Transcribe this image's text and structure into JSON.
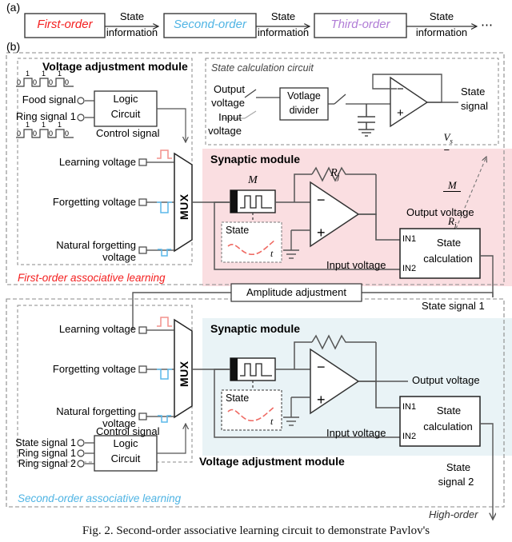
{
  "figure": {
    "panel_a_label": "(a)",
    "panel_b_label": "(b)",
    "caption": "Fig. 2.   Second-order associative learning circuit to demonstrate Pavlov's"
  },
  "colors": {
    "first_order": "#f42020",
    "second_order": "#4fb4e4",
    "third_order": "#b07cd6",
    "pink_panel": "#fadee1",
    "blue_panel": "#e9f3f6",
    "learning_pulse": "#f4918c",
    "forgetting_pulse": "#5bb8ea",
    "state_curve": "#ef6a63",
    "wire": "#595959"
  },
  "panel_a": {
    "blocks": [
      {
        "label": "First-order",
        "color": "#f42020"
      },
      {
        "label": "Second-order",
        "color": "#4fb4e4"
      },
      {
        "label": "Third-order",
        "color": "#b07cd6"
      }
    ],
    "arrow_labels": [
      {
        "line1": "State",
        "line2": "information"
      },
      {
        "line1": "State",
        "line2": "information"
      },
      {
        "line1": "State",
        "line2": "information"
      }
    ],
    "ellipsis": "⋯"
  },
  "first_order": {
    "section_label": "First-order associative learning",
    "voltage_adjustment": {
      "title": "Voltage adjustment module",
      "waveform_top": {
        "bits": [
          "0",
          "1",
          "0",
          "1",
          "0",
          "1",
          "0"
        ]
      },
      "waveform_bottom": {
        "bits": [
          "0",
          "1",
          "0",
          "1",
          "0",
          "1",
          "0"
        ]
      },
      "inputs": [
        {
          "label": "Food signal"
        },
        {
          "label": "Ring signal 1"
        }
      ],
      "logic_block": {
        "line1": "Logic",
        "line2": "Circuit"
      },
      "control_signal": "Control signal",
      "mux_label": "MUX",
      "mux_inputs": [
        {
          "label": "Learning voltage",
          "pulse": "up",
          "color": "#f4918c"
        },
        {
          "label": "Forgetting voltage",
          "pulse": "down",
          "color": "#5bb8ea"
        },
        {
          "label": "Natural forgetting\nvoltage",
          "pulse": "down-small",
          "color": "#5bb8ea"
        }
      ]
    },
    "state_calculation_circuit": {
      "title": "State calculation circuit",
      "input_a": {
        "line1": "Output",
        "line2": "voltage"
      },
      "input_b": {
        "line1": "Input",
        "line2": "voltage"
      },
      "divider": {
        "line1": "Votlage",
        "line2": "divider"
      },
      "output": {
        "line1": "State",
        "line2": "signal"
      },
      "formula": {
        "lhs": "V",
        "lhs_sub": "s",
        "op": "−",
        "num": "M",
        "den": "R",
        "den_sub": "j"
      }
    },
    "synaptic_module": {
      "title": "Synaptic module",
      "memristor_label": "M",
      "resistor_label": "R",
      "resistor_sub": "j",
      "opamp_minus": "−",
      "opamp_plus": "+",
      "state_inset": {
        "label": "State",
        "axis": "t"
      },
      "output_voltage": "Output voltage",
      "input_voltage": "Input voltage",
      "state_calc_block": {
        "in1": "IN1",
        "in2": "IN2",
        "line1": "State",
        "line2": "calculation"
      }
    }
  },
  "interconnect": {
    "amplitude_adjustment": "Amplitude adjustment",
    "state_signal_1": "State signal 1",
    "state_signal_2": {
      "line1": "State",
      "line2": "signal 2"
    },
    "high_order": "High-order"
  },
  "second_order": {
    "section_label": "Second-order associative learning",
    "voltage_adjustment": {
      "title": "Voltage adjustment module",
      "mux_label": "MUX",
      "mux_inputs": [
        {
          "label": "Learning voltage",
          "pulse": "up",
          "color": "#f4918c"
        },
        {
          "label": "Forgetting voltage",
          "pulse": "down",
          "color": "#5bb8ea"
        },
        {
          "label": "Natural forgetting\nvoltage",
          "pulse": "down-small",
          "color": "#5bb8ea"
        }
      ],
      "control_signal": "Control signal",
      "inputs": [
        {
          "label": "State signal 1"
        },
        {
          "label": "Ring signal 1"
        },
        {
          "label": "Ring signal 2"
        }
      ],
      "logic_block": {
        "line1": "Logic",
        "line2": "Circuit"
      }
    },
    "synaptic_module": {
      "title": "Synaptic module",
      "opamp_minus": "−",
      "opamp_plus": "+",
      "state_inset": {
        "label": "State",
        "axis": "t"
      },
      "output_voltage": "Output voltage",
      "input_voltage": "Input voltage",
      "state_calc_block": {
        "in1": "IN1",
        "in2": "IN2",
        "line1": "State",
        "line2": "calculation"
      }
    }
  }
}
